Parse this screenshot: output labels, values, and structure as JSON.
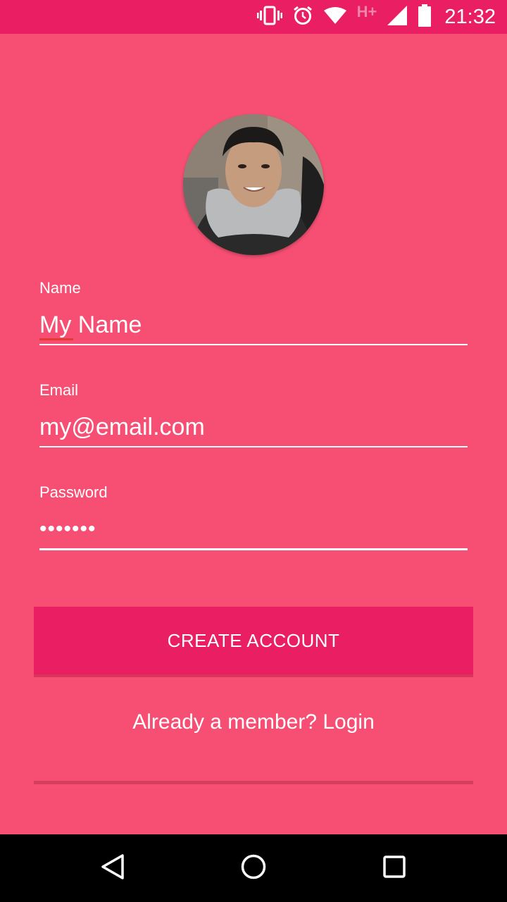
{
  "status_bar": {
    "network_type": "H+",
    "time": "21:32",
    "icons": [
      "vibrate-icon",
      "alarm-icon",
      "wifi-icon",
      "cell-signal-icon",
      "battery-icon"
    ]
  },
  "avatar": {
    "icon": "profile-photo"
  },
  "form": {
    "name": {
      "label": "Name",
      "value": "My Name"
    },
    "email": {
      "label": "Email",
      "value": "my@email.com"
    },
    "password": {
      "label": "Password",
      "value": "•••••••"
    }
  },
  "actions": {
    "create_account_label": "CREATE ACCOUNT",
    "login_link_label": "Already a member? Login"
  },
  "nav_bar": {
    "icons": [
      "back-icon",
      "home-icon",
      "recents-icon"
    ]
  },
  "colors": {
    "background": "#f64f73",
    "status_bar": "#e91e63",
    "button": "#e91e63",
    "spell_check": "#e53935"
  }
}
